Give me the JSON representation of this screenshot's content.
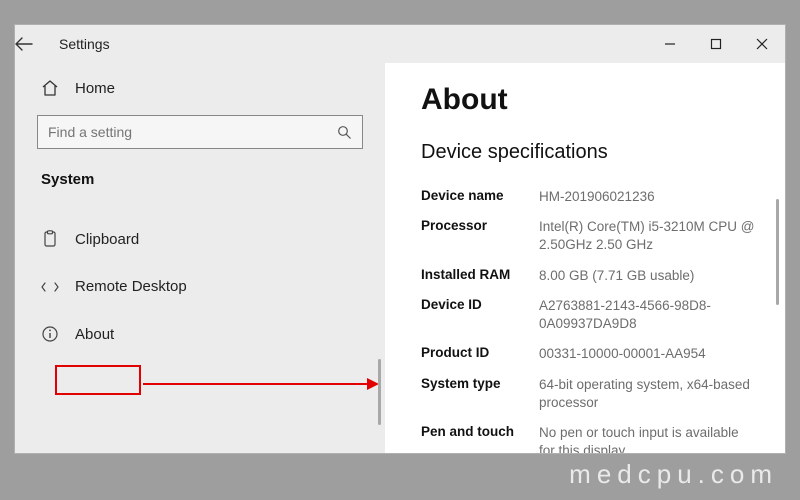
{
  "window": {
    "title": "Settings"
  },
  "sidebar": {
    "home_label": "Home",
    "search_placeholder": "Find a setting",
    "category": "System",
    "items": [
      {
        "label": "Clipboard"
      },
      {
        "label": "Remote Desktop"
      },
      {
        "label": "About"
      }
    ]
  },
  "content": {
    "heading": "About",
    "section": "Device specifications",
    "specs": [
      {
        "label": "Device name",
        "value": "HM-201906021236"
      },
      {
        "label": "Processor",
        "value": "Intel(R) Core(TM) i5-3210M CPU @ 2.50GHz   2.50 GHz"
      },
      {
        "label": "Installed RAM",
        "value": "8.00 GB (7.71 GB usable)"
      },
      {
        "label": "Device ID",
        "value": "A2763881-2143-4566-98D8-0A09937DA9D8"
      },
      {
        "label": "Product ID",
        "value": "00331-10000-00001-AA954"
      },
      {
        "label": "System type",
        "value": "64-bit operating system, x64-based processor"
      },
      {
        "label": "Pen and touch",
        "value": "No pen or touch input is available for this display"
      }
    ]
  },
  "watermark": "medcpu.com"
}
